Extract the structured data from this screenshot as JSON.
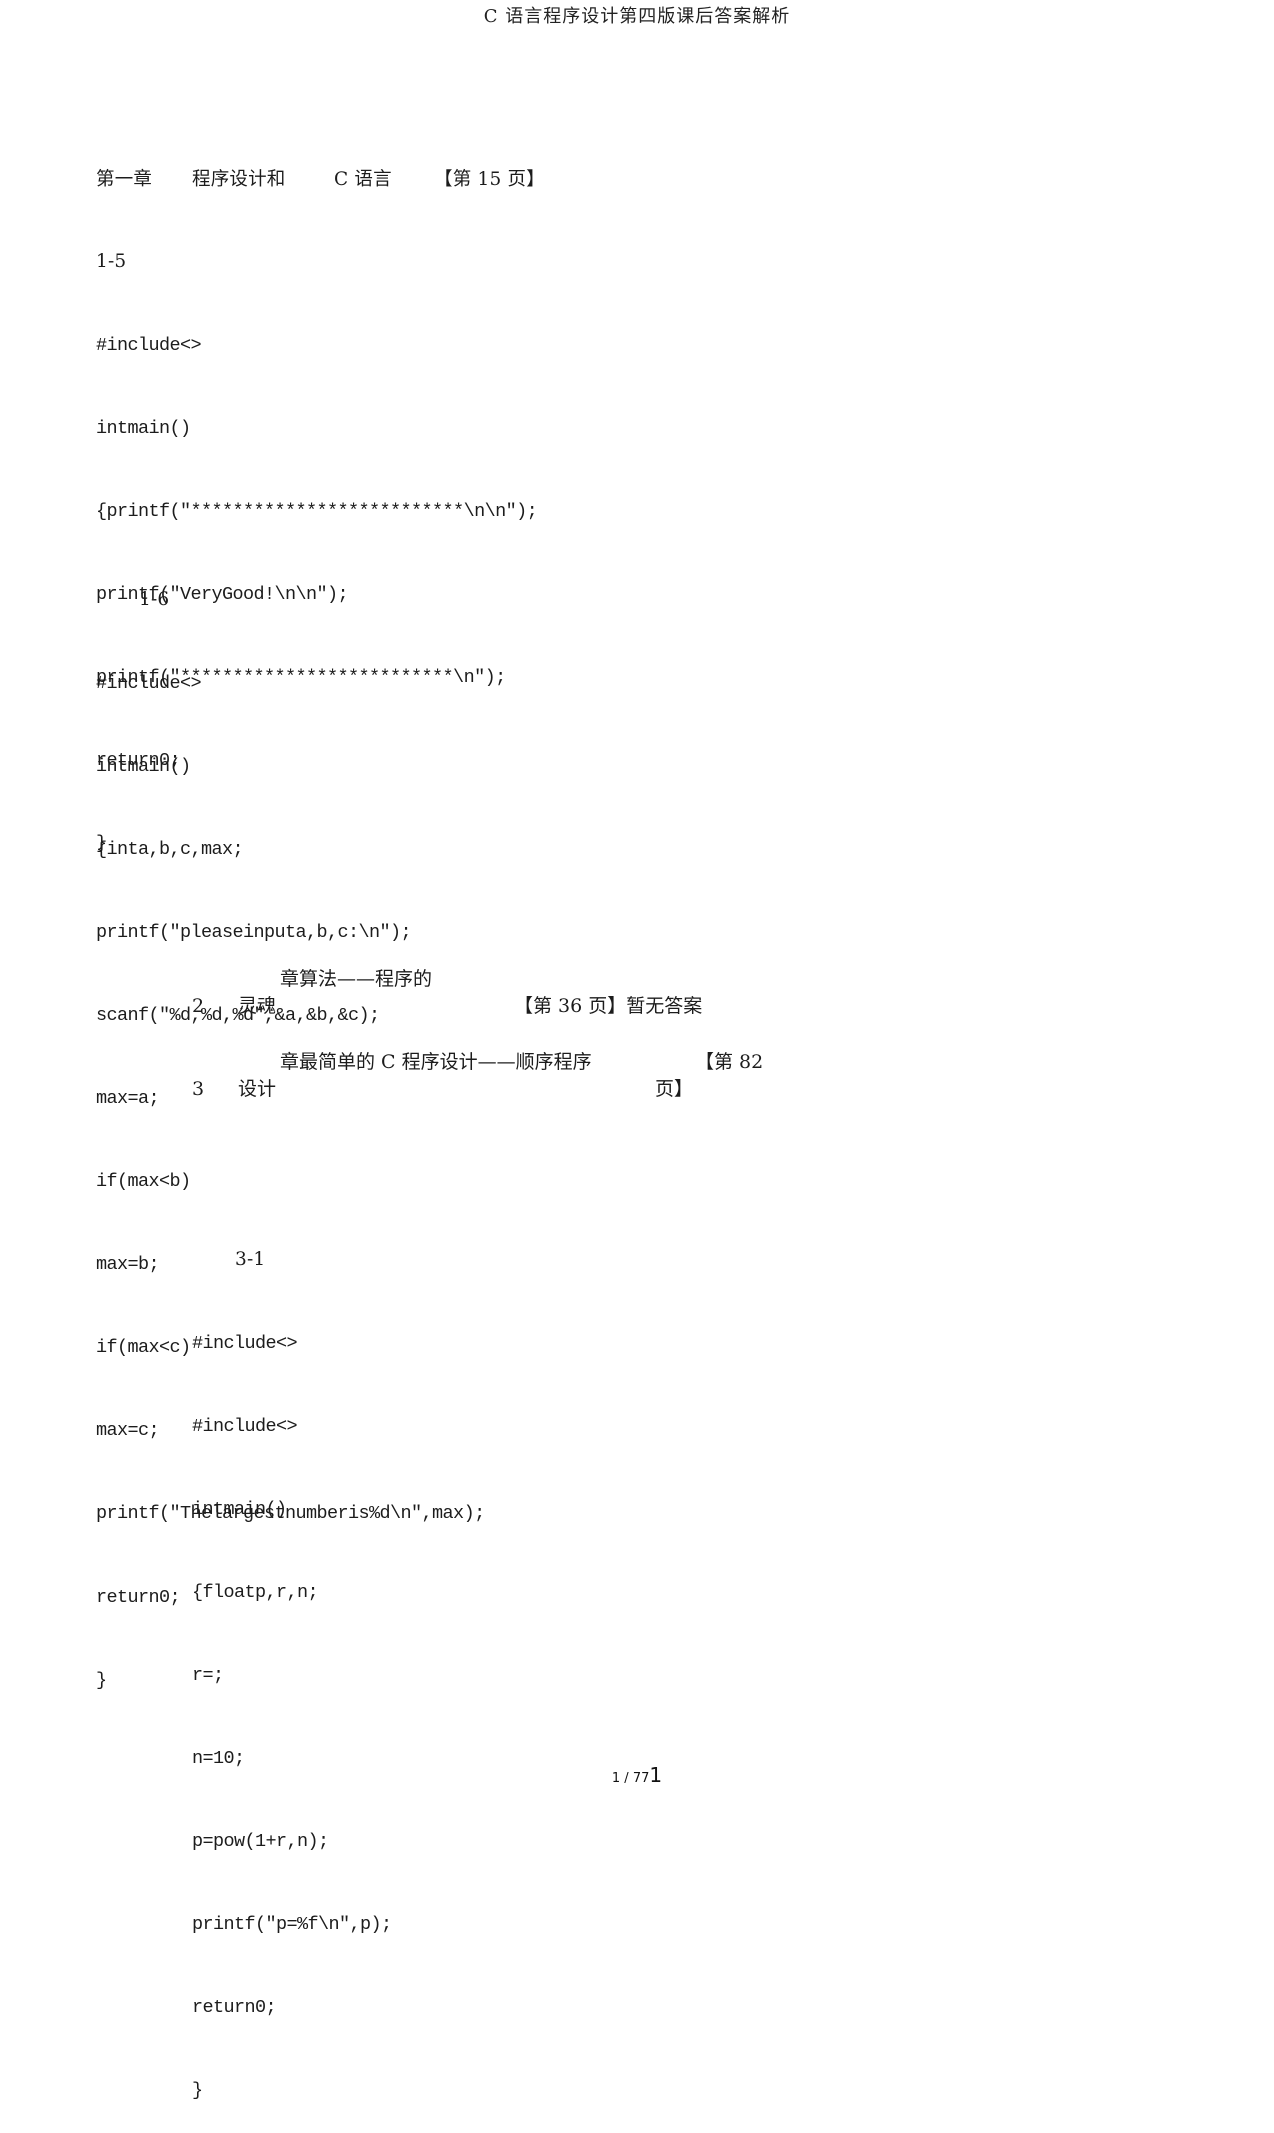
{
  "header": {
    "title": "C 语言程序设计第四版课后答案解析"
  },
  "chapter1": {
    "chapter": "第一章",
    "title": "程序设计和",
    "subject": "C 语言",
    "page_ref": "【第 15 页】"
  },
  "section_1_5": {
    "label": "1-5",
    "code": [
      "#include<>",
      "intmain()",
      "{printf(\"**************************\\n\\n\");",
      "printf(\"VeryGood!\\n\\n\");",
      "printf(\"**************************\\n\");",
      "return0;",
      "}"
    ]
  },
  "section_1_6": {
    "label": "1-6",
    "code": [
      "#include<>",
      "intmain()",
      "{inta,b,c,max;",
      "printf(\"pleaseinputa,b,c:\\n\");",
      "scanf(\"%d,%d,%d\",&a,&b,&c);",
      "max=a;",
      "if(max<b)",
      "max=b;",
      "if(max<c)",
      "max=c;",
      "printf(\"Thelargestnumberis%d\\n\",max);",
      "return0;",
      "}"
    ]
  },
  "chapter2": {
    "number": "2",
    "title_line1": "章算法——程序的",
    "title_line2": "灵魂",
    "page_ref": "【第 36 页】暂无答案"
  },
  "chapter3": {
    "number": "3",
    "title_line1": "章最简单的 C 程序设计——顺序程序",
    "title_line2": "设计",
    "page_ref_line1": "【第 82",
    "page_ref_line2": "页】"
  },
  "section_3_1": {
    "label": "3-1",
    "code": [
      "#include<>",
      "#include<>",
      "intmain()",
      "{floatp,r,n;",
      "r=;",
      "n=10;",
      "p=pow(1+r,n);",
      "printf(\"p=%f\\n\",p);",
      "return0;",
      "}"
    ]
  },
  "footer": {
    "page_current": "1",
    "page_total": "77",
    "page_number_large": "1"
  }
}
